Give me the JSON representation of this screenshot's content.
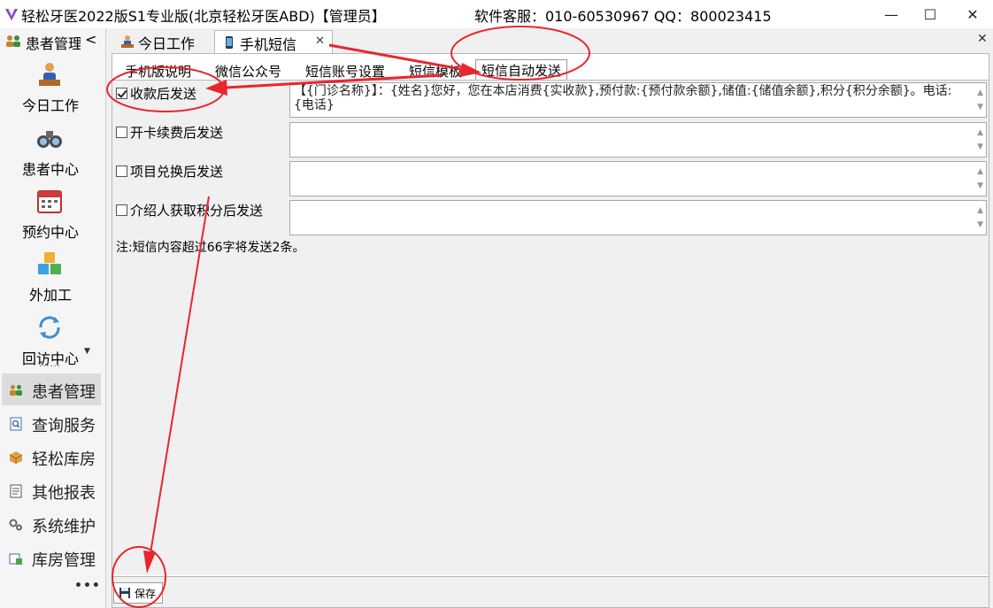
{
  "window": {
    "title": "轻松牙医2022版S1专业版(北京轻松牙医ABD)【管理员】",
    "service": "软件客服：010-60530967 QQ：800023415",
    "min_icon": "minimize-icon",
    "max_icon": "maximize-icon",
    "close_icon": "close-icon",
    "min_glyph": "—",
    "max_glyph": "☐",
    "close_glyph": "✕"
  },
  "sidebar": {
    "header": "患者管理",
    "collapse_glyph": "<",
    "big_items": [
      {
        "label": "今日工作",
        "icon": "worker-icon"
      },
      {
        "label": "患者中心",
        "icon": "binoculars-icon"
      },
      {
        "label": "预约中心",
        "icon": "calendar-icon"
      },
      {
        "label": "外加工",
        "icon": "cubes-icon"
      },
      {
        "label": "回访中心",
        "icon": "refresh-icon"
      }
    ],
    "more_glyph": "▼",
    "dots_small": "......",
    "list_items": [
      {
        "label": "患者管理",
        "icon": "users-icon",
        "active": true
      },
      {
        "label": "查询服务",
        "icon": "search-doc-icon"
      },
      {
        "label": "轻松库房",
        "icon": "box-icon"
      },
      {
        "label": "其他报表",
        "icon": "report-icon"
      },
      {
        "label": "系统维护",
        "icon": "gears-icon"
      },
      {
        "label": "库房管理",
        "icon": "warehouse-icon"
      }
    ],
    "more_dots": "•••"
  },
  "tabs": [
    {
      "label": "今日工作",
      "icon": "worker-icon"
    },
    {
      "label": "手机短信",
      "icon": "phone-icon",
      "active": true,
      "close_glyph": "✕"
    }
  ],
  "main_close_glyph": "✕",
  "subtabs": [
    {
      "label": "手机版说明"
    },
    {
      "label": "微信公众号"
    },
    {
      "label": "短信账号设置"
    },
    {
      "label": "短信模板"
    },
    {
      "label": "短信自动发送",
      "active": true
    }
  ],
  "rows": [
    {
      "label": "收款后发送",
      "checked": true,
      "text": "【{门诊名称}】：{姓名}您好，您在本店消费{实收款},预付款:{预付款余额},储值:{储值余额},积分{积分余额}。电话:{电话}"
    },
    {
      "label": "开卡续费后发送",
      "checked": false,
      "text": ""
    },
    {
      "label": "项目兑换后发送",
      "checked": false,
      "text": ""
    },
    {
      "label": "介绍人获取积分后发送",
      "checked": false,
      "text": ""
    }
  ],
  "scroll_up_glyph": "▲",
  "scroll_down_glyph": "▼",
  "note": "注:短信内容超过66字将发送2条。",
  "save_label": "保存",
  "colors": {
    "annotation": "#e8262d",
    "panel_bg": "#ffffff",
    "window_bg": "#f0f0f0"
  }
}
